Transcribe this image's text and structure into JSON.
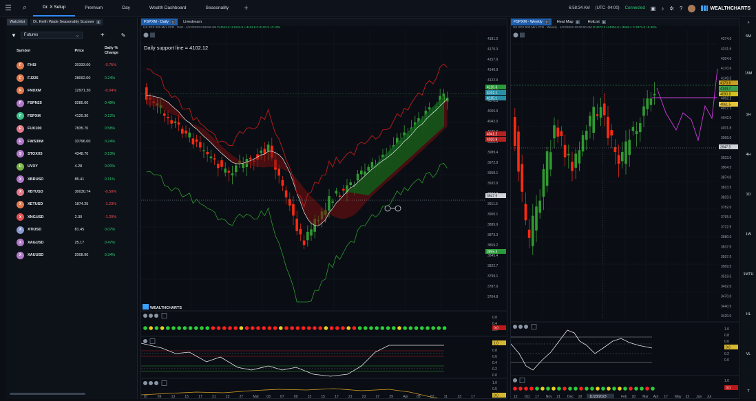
{
  "nav": {
    "tabs": [
      {
        "label": "Dr. X Setup",
        "active": true
      },
      {
        "label": "Premium",
        "active": false
      },
      {
        "label": "Day",
        "active": false
      },
      {
        "label": "Wealth Dashboard",
        "active": false
      },
      {
        "label": "Seasonality",
        "active": false
      }
    ],
    "time": "6:58:34 AM",
    "timezone": "(UTC -04:00)",
    "connection": "Connected",
    "brand": "WEALTHCHARTS"
  },
  "watchlist": {
    "tabs": [
      {
        "label": "Watchlist"
      },
      {
        "label": "Dr. Keith Wade Seasonality Scanner"
      }
    ],
    "selected_list": "Futures",
    "columns": {
      "symbol": "Symbol",
      "price": "Price",
      "change": "Daily % Change"
    },
    "rows": [
      {
        "letter": "F",
        "color": "#e07a4f",
        "symbol": "FHSI",
        "price": "20333.00",
        "change": "-0.75%",
        "dir": "neg"
      },
      {
        "letter": "F",
        "color": "#e07a4f",
        "symbol": "FJ225",
        "price": "28092.00",
        "change": "0.24%",
        "dir": "pos"
      },
      {
        "letter": "F",
        "color": "#e07a4f",
        "symbol": "FNDXM",
        "price": "12971.20",
        "change": "-0.04%",
        "dir": "neg"
      },
      {
        "letter": "F",
        "color": "#b07ac8",
        "symbol": "FSPN25",
        "price": "9285.60",
        "change": "0.48%",
        "dir": "pos"
      },
      {
        "letter": "F",
        "color": "#3fbf8a",
        "symbol": "FSPXM",
        "price": "4120.30",
        "change": "0.12%",
        "dir": "pos"
      },
      {
        "letter": "F",
        "color": "#e07a8a",
        "symbol": "FUK100",
        "price": "7835.70",
        "change": "0.58%",
        "dir": "pos"
      },
      {
        "letter": "F",
        "color": "#b07ac8",
        "symbol": "FWS30M",
        "price": "33796.00",
        "change": "0.24%",
        "dir": "pos"
      },
      {
        "letter": "S",
        "color": "#b07ac8",
        "symbol": "STOXX5",
        "price": "4348.70",
        "change": "0.13%",
        "dir": "pos"
      },
      {
        "letter": "U",
        "color": "#7ab04a",
        "symbol": "UVXY",
        "price": "4.28",
        "change": "0.00%",
        "dir": "pos"
      },
      {
        "letter": "X",
        "color": "#b07ac8",
        "symbol": "XBRUSD",
        "price": "85.41",
        "change": "0.11%",
        "dir": "pos"
      },
      {
        "letter": "X",
        "color": "#e07a8a",
        "symbol": "XBTUSD",
        "price": "30030.74",
        "change": "-0.50%",
        "dir": "neg"
      },
      {
        "letter": "X",
        "color": "#e07a4f",
        "symbol": "XETUSD",
        "price": "1874.25",
        "change": "-1.23%",
        "dir": "neg"
      },
      {
        "letter": "X",
        "color": "#e05050",
        "symbol": "XNGUSD",
        "price": "2.30",
        "change": "-1.20%",
        "dir": "neg"
      },
      {
        "letter": "X",
        "color": "#8a9ad0",
        "symbol": "XTIUSD",
        "price": "81.45",
        "change": "0.07%",
        "dir": "pos"
      },
      {
        "letter": "X",
        "color": "#b07ac8",
        "symbol": "XAGUSD",
        "price": "25.17",
        "change": "0.47%",
        "dir": "pos"
      },
      {
        "letter": "X",
        "color": "#b07ac8",
        "symbol": "XAUUSD",
        "price": "2008.90",
        "change": "0.34%",
        "dir": "pos"
      }
    ]
  },
  "chart1": {
    "tabs": [
      {
        "label": "FSPXM - Daily",
        "num": "1"
      },
      {
        "label": "Livestream"
      }
    ],
    "info_left": "US SPX 500 Mini CFD · D/W · 4/12/2023 6:58:52 AM",
    "info_right": "O:4112.2 H:4124.6 L:4111.9 C:4120.3 +0.13%",
    "annotation": "Daily support line = 4102.12",
    "watermark": "WEALTHCHARTS",
    "price_axis": [
      "4181.0",
      "4170.3",
      "4157.9",
      "4140.9",
      "4122.9",
      "4091.3",
      "4070.5",
      "4055.9",
      "4042.0",
      "4025.6",
      "4000.5",
      "3989.4",
      "3972.9",
      "3958.1",
      "3932.9",
      "3924.3",
      "3911.5",
      "3900.1",
      "3889.9",
      "3873.3",
      "3859.2",
      "3845.4",
      "3822.7",
      "3799.1",
      "3787.9",
      "3764.8"
    ],
    "price_tags": [
      {
        "label": "4120.3",
        "color": "#2b9a3a"
      },
      {
        "label": "4102.1",
        "color": "#2a8fa8"
      },
      {
        "label": "4115.1",
        "color": "#2a8fa8"
      },
      {
        "label": "4041.2",
        "color": "#b22222"
      },
      {
        "label": "4020.9",
        "color": "#b22222"
      },
      {
        "label": "3947.5",
        "color": "#d0d4da"
      },
      {
        "label": "3855.3",
        "color": "#2b9a3a"
      }
    ],
    "x_axis": [
      "07",
      "09",
      "13",
      "15",
      "17",
      "21",
      "23",
      "27",
      "Mar",
      "03",
      "07",
      "09",
      "13",
      "15",
      "17",
      "21",
      "23",
      "27",
      "29",
      "Apr",
      "05",
      "07",
      "11",
      "13",
      "17"
    ],
    "osc1_axis": [
      "0.8",
      "0.4",
      "0.0"
    ],
    "osc1_tag": "0.0",
    "osc2_axis": [
      "1.0",
      "0.8",
      "0.6",
      "0.4",
      "0.2",
      "0.0"
    ],
    "osc2_tag": "1.0",
    "osc3_axis": [
      "1.0",
      "0.5",
      "0.0"
    ],
    "osc3_tag": "0.0"
  },
  "chart2": {
    "tabs": [
      {
        "label": "FSPXM - Weekly",
        "num": "7"
      },
      {
        "label": "Heat Map",
        "num": "8"
      },
      {
        "label": "HotList",
        "num": "9"
      }
    ],
    "info_left": "US SPX 500 Mini CFD · Weekly · 1/23/2023 12:00:00 AM",
    "info_right": "O:4072.2 H:4094.8 L:3949.1 C:4071.0 +0.40%",
    "price_axis": [
      "4274.0",
      "4241.6",
      "4204.0",
      "4170.6",
      "4149.5",
      "4119.5",
      "4092.2",
      "4077.2",
      "4042.0",
      "4031.8",
      "3999.0",
      "3955.5",
      "3933.0",
      "3904.5",
      "3874.0",
      "3823.5",
      "3829.5",
      "3782.0",
      "3765.5",
      "3722.5",
      "3680.0",
      "3637.0",
      "3597.0",
      "3569.5",
      "3519.5",
      "3492.0",
      "3470.0",
      "3440.5",
      "3420.0"
    ],
    "price_tags": [
      {
        "label": "4170.6",
        "color": "#c8a020"
      },
      {
        "label": "4144.7",
        "color": "#3aa050"
      },
      {
        "label": "4090.8",
        "color": "#d4c020"
      },
      {
        "label": "4061.5",
        "color": "#e8c43a"
      },
      {
        "label": "3947.5",
        "color": "#d0d4da"
      }
    ],
    "x_axis": [
      "12",
      "Oct",
      "17",
      "Nov",
      "21",
      "Dec",
      "19",
      "2023",
      "Jan",
      "23",
      "Feb",
      "20",
      "Mar",
      "Apr",
      "17",
      "May",
      "22",
      "Jun",
      "Jul"
    ],
    "date_marker": "11/23/2023",
    "osc1_axis": [
      "1.0",
      "0.8",
      "0.6",
      "0.4",
      "0.2",
      "0.0"
    ],
    "osc1_tag": "0.6",
    "osc2_axis": [
      "1.0",
      "0.0"
    ],
    "osc2_tag": "0.0"
  },
  "timeframes": [
    "5M",
    "15M",
    "1H",
    "4H",
    "1D",
    "1W",
    "1MTH",
    "HL",
    "VL",
    "T"
  ]
}
